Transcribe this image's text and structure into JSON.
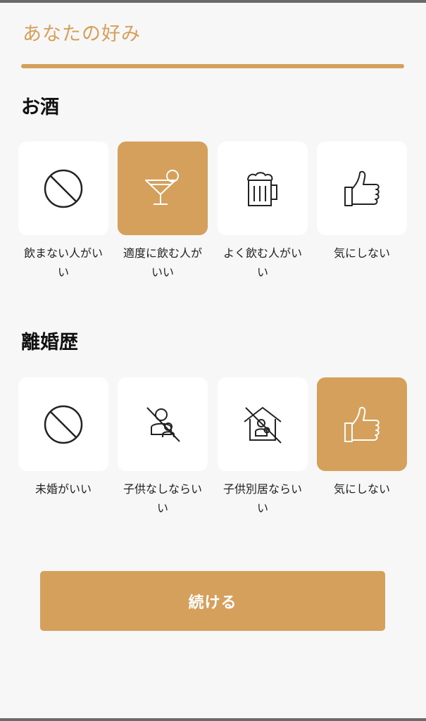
{
  "header": {
    "title": "あなたの好み"
  },
  "colors": {
    "accent": "#d4a05c",
    "tile": "#ffffff",
    "background": "#f7f7f7"
  },
  "sections": [
    {
      "heading": "お酒",
      "options": [
        {
          "label": "飲まない人がいい",
          "icon": "prohibited-icon",
          "selected": false
        },
        {
          "label": "適度に飲む人がいい",
          "icon": "cocktail-icon",
          "selected": true
        },
        {
          "label": "よく飲む人がいい",
          "icon": "beer-mug-icon",
          "selected": false
        },
        {
          "label": "気にしない",
          "icon": "thumbs-up-icon",
          "selected": false
        }
      ]
    },
    {
      "heading": "離婚歴",
      "options": [
        {
          "label": "未婚がいい",
          "icon": "prohibited-icon",
          "selected": false
        },
        {
          "label": "子供なしならいい",
          "icon": "no-children-icon",
          "selected": false
        },
        {
          "label": "子供別居ならいい",
          "icon": "no-children-home-icon",
          "selected": false
        },
        {
          "label": "気にしない",
          "icon": "thumbs-up-icon",
          "selected": true
        }
      ]
    }
  ],
  "footer": {
    "continue_label": "続ける"
  }
}
